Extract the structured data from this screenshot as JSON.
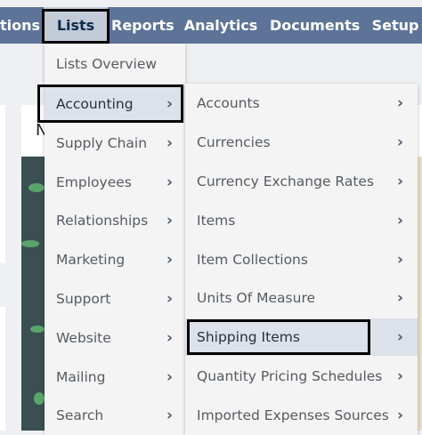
{
  "nav": {
    "items": [
      {
        "label": "tions"
      },
      {
        "label": "Lists"
      },
      {
        "label": "Reports"
      },
      {
        "label": "Analytics"
      },
      {
        "label": "Documents"
      },
      {
        "label": "Setup"
      }
    ]
  },
  "page": {
    "heading_fragment": "N"
  },
  "lists_menu": {
    "items": [
      {
        "label": "Lists Overview"
      },
      {
        "label": "Accounting"
      },
      {
        "label": "Supply Chain"
      },
      {
        "label": "Employees"
      },
      {
        "label": "Relationships"
      },
      {
        "label": "Marketing"
      },
      {
        "label": "Support"
      },
      {
        "label": "Website"
      },
      {
        "label": "Mailing"
      },
      {
        "label": "Search"
      }
    ]
  },
  "accounting_menu": {
    "items": [
      {
        "label": "Accounts"
      },
      {
        "label": "Currencies"
      },
      {
        "label": "Currency Exchange Rates"
      },
      {
        "label": "Items"
      },
      {
        "label": "Item Collections"
      },
      {
        "label": "Units Of Measure"
      },
      {
        "label": "Shipping Items"
      },
      {
        "label": "Quantity Pricing Schedules"
      },
      {
        "label": "Imported Expenses Sources"
      }
    ]
  },
  "icons": {
    "submenu_arrow": "chevron-right-icon"
  },
  "colors": {
    "nav_bg": "#5d7498",
    "nav_active_bg": "#c3cbd8",
    "menu_bg": "#f4f4f4",
    "highlight_bg": "#dce1ea"
  }
}
